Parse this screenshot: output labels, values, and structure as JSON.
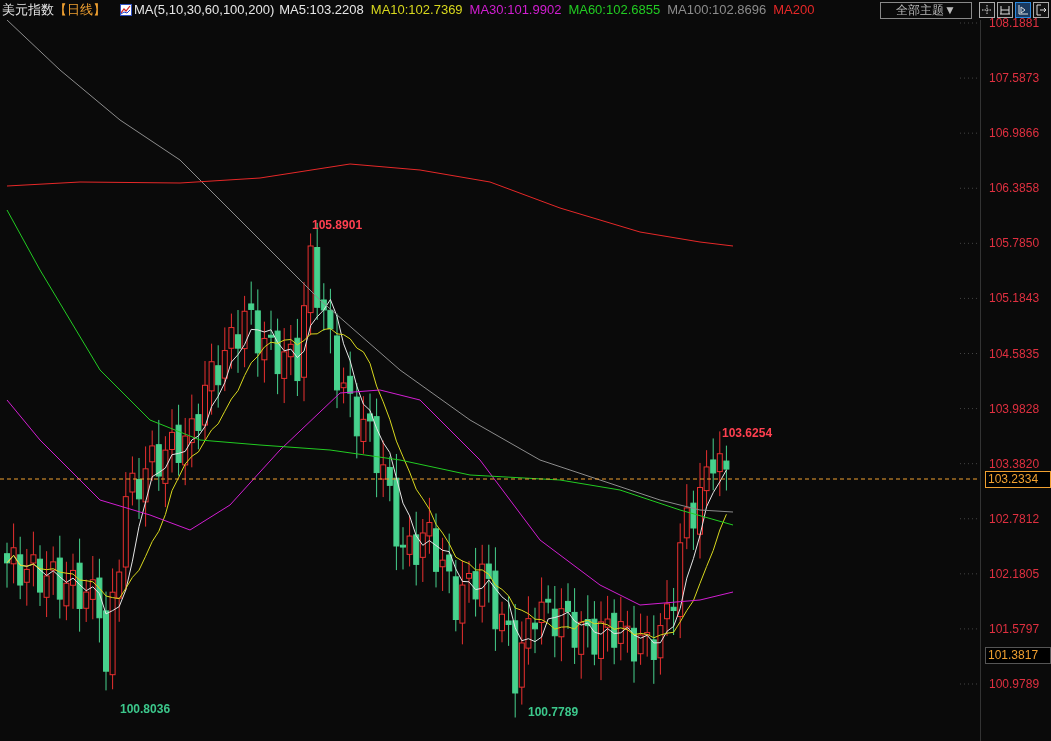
{
  "header": {
    "title": "美元指数",
    "period": "【日线】",
    "indicator_name": "MA(5,10,30,60,100,200)"
  },
  "indicators": [
    {
      "label": "MA5:103.2208",
      "color": "#e6e6e6"
    },
    {
      "label": "MA10:102.7369",
      "color": "#d8d81e"
    },
    {
      "label": "MA30:101.9902",
      "color": "#d21ed2"
    },
    {
      "label": "MA60:102.6855",
      "color": "#22cc22"
    },
    {
      "label": "MA100:102.8696",
      "color": "#8c8c8c"
    },
    {
      "label": "MA200",
      "color": "#e62828"
    }
  ],
  "theme_dropdown": {
    "label": "全部主题▼"
  },
  "toolbar": [
    {
      "selected": false
    },
    {
      "selected": false
    },
    {
      "selected": true
    },
    {
      "selected": false
    }
  ],
  "price_axis": [
    "108.1881",
    "107.5873",
    "106.9866",
    "106.3858",
    "105.7850",
    "105.1843",
    "104.5835",
    "103.9828",
    "103.3820",
    "102.7812",
    "102.1805",
    "101.5797",
    "100.9789"
  ],
  "current_price": "103.2334",
  "cursor_price": "101.3817",
  "annotations": [
    {
      "text": "105.8901",
      "kind": "high"
    },
    {
      "text": "103.6254",
      "kind": "high"
    },
    {
      "text": "100.8036",
      "kind": "low"
    },
    {
      "text": "100.7789",
      "kind": "low"
    }
  ]
}
